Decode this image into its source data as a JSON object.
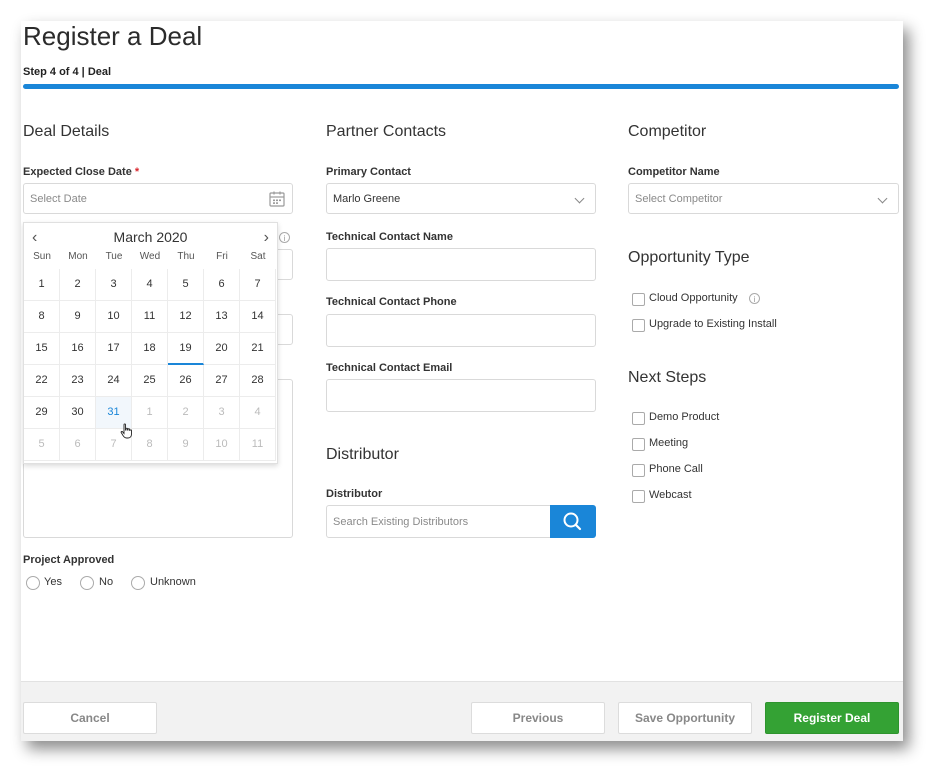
{
  "page": {
    "title": "Register a Deal",
    "step": "Step 4 of 4  |  Deal"
  },
  "deal_details": {
    "heading": "Deal Details",
    "expected_close_label": "Expected Close Date",
    "required_marker": "*",
    "date_placeholder": "Select Date",
    "project_approved_label": "Project Approved",
    "radios": [
      "Yes",
      "No",
      "Unknown"
    ]
  },
  "calendar": {
    "month": "March 2020",
    "prev": "‹",
    "next": "›",
    "weekdays": [
      "Sun",
      "Mon",
      "Tue",
      "Wed",
      "Thu",
      "Fri",
      "Sat"
    ],
    "weeks": [
      [
        "1",
        "2",
        "3",
        "4",
        "5",
        "6",
        "7"
      ],
      [
        "8",
        "9",
        "10",
        "11",
        "12",
        "13",
        "14"
      ],
      [
        "15",
        "16",
        "17",
        "18",
        "19",
        "20",
        "21"
      ],
      [
        "22",
        "23",
        "24",
        "25",
        "26",
        "27",
        "28"
      ],
      [
        "29",
        "30",
        "31",
        "1",
        "2",
        "3",
        "4"
      ],
      [
        "5",
        "6",
        "7",
        "8",
        "9",
        "10",
        "11"
      ]
    ],
    "selected_day": "31",
    "today_day": "19"
  },
  "partner_contacts": {
    "heading": "Partner Contacts",
    "primary_label": "Primary Contact",
    "primary_value": "Marlo Greene",
    "tech_name_label": "Technical Contact Name",
    "tech_phone_label": "Technical Contact Phone",
    "tech_email_label": "Technical Contact Email"
  },
  "distributor": {
    "heading": "Distributor",
    "label": "Distributor",
    "placeholder": "Search Existing Distributors"
  },
  "competitor": {
    "heading": "Competitor",
    "name_label": "Competitor Name",
    "placeholder": "Select Competitor"
  },
  "opportunity_type": {
    "heading": "Opportunity Type",
    "options": [
      "Cloud Opportunity",
      "Upgrade to Existing Install"
    ]
  },
  "next_steps": {
    "heading": "Next Steps",
    "options": [
      "Demo Product",
      "Meeting",
      "Phone Call",
      "Webcast"
    ]
  },
  "footer": {
    "cancel": "Cancel",
    "previous": "Previous",
    "save": "Save Opportunity",
    "register": "Register Deal"
  },
  "colors": {
    "accent": "#1a86d8",
    "primary_button": "#34a234",
    "required": "#d9272e"
  },
  "icons": [
    "calendar-icon",
    "chevron-down-icon",
    "info-icon",
    "search-icon",
    "hand-cursor-icon"
  ]
}
